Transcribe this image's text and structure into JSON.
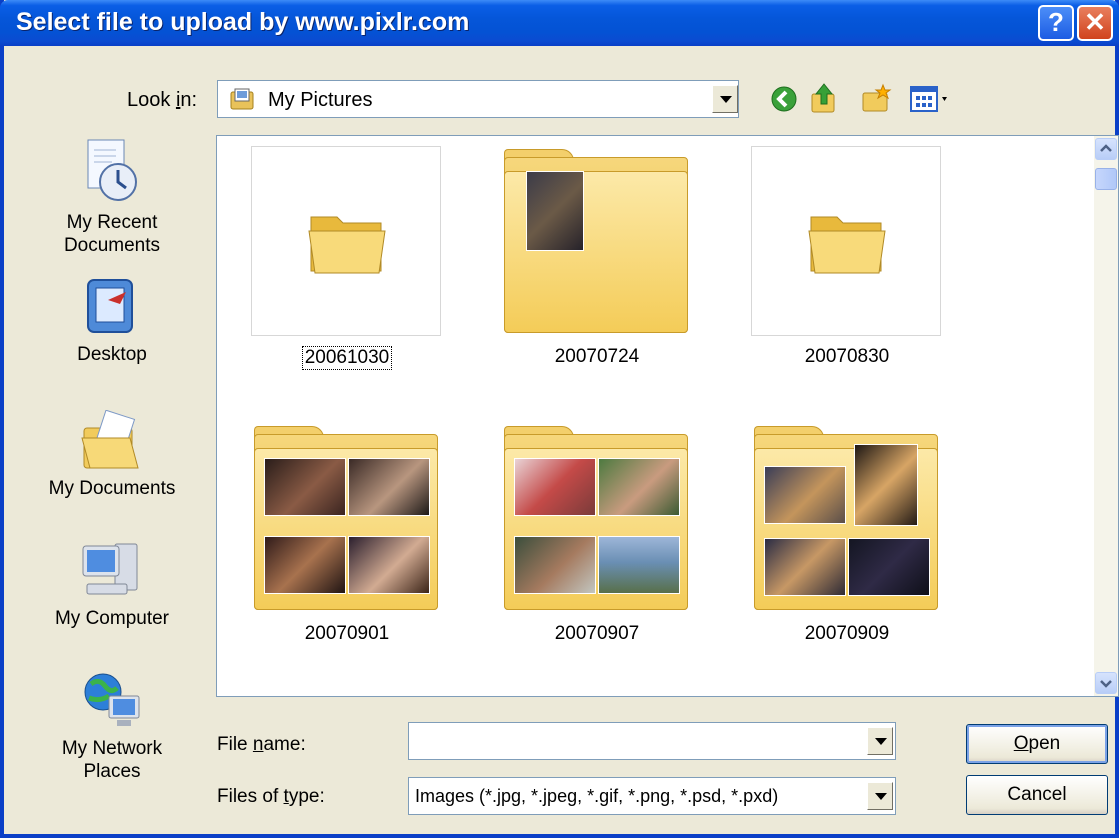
{
  "window": {
    "title": "Select file to upload by www.pixlr.com",
    "help_label": "?",
    "close_label": "✕"
  },
  "look_in": {
    "label_pre": "Look ",
    "label_key": "i",
    "label_post": "n:",
    "value": "My Pictures"
  },
  "places": [
    {
      "label": "My Recent Documents",
      "icon": "recent-documents-icon"
    },
    {
      "label": "Desktop",
      "icon": "desktop-icon"
    },
    {
      "label": "My Documents",
      "icon": "my-documents-icon"
    },
    {
      "label": "My Computer",
      "icon": "my-computer-icon"
    },
    {
      "label": "My Network Places",
      "icon": "network-places-icon"
    }
  ],
  "places_lines": {
    "recent_1": "My Recent",
    "recent_2": "Documents",
    "desktop": "Desktop",
    "documents": "My Documents",
    "computer": "My Computer",
    "network_1": "My Network",
    "network_2": "Places"
  },
  "files": [
    {
      "name": "20061030",
      "thumb": "empty-folder",
      "focused": true
    },
    {
      "name": "20070724",
      "thumb": "folder-1-photo"
    },
    {
      "name": "20070830",
      "thumb": "empty-folder"
    },
    {
      "name": "20070901",
      "thumb": "folder-4-photos"
    },
    {
      "name": "20070907",
      "thumb": "folder-4-photos"
    },
    {
      "name": "20070909",
      "thumb": "folder-4-photos"
    }
  ],
  "file_name": {
    "label_pre": "File ",
    "label_key": "n",
    "label_post": "ame:",
    "value": ""
  },
  "file_type": {
    "label_pre": "Files of ",
    "label_key": "t",
    "label_post": "ype:",
    "value": "Images (*.jpg, *.jpeg, *.gif, *.png, *.psd, *.pxd)"
  },
  "buttons": {
    "open_key": "O",
    "open_rest": "pen",
    "cancel": "Cancel"
  },
  "colors": {
    "title_bar": "#0554d6",
    "dialog_bg": "#ece9d8",
    "folder": "#f4cc58"
  }
}
